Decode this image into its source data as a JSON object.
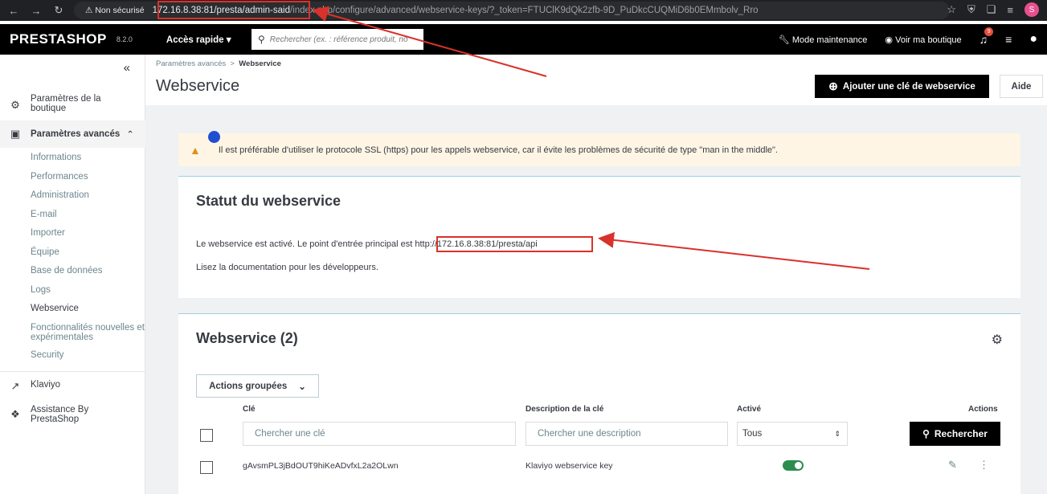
{
  "browser": {
    "security_label": "Non sécurisé",
    "url_host": "172.16.8.38:81/presta/admin-said",
    "url_rest": "/index.php/configure/advanced/webservice-keys/?_token=FTUClK9dQk2zfb-9D_PuDkcCUQMiD6b0EMmbolv_Rro",
    "profile_initial": "S"
  },
  "header": {
    "logo": "PRESTASHOP",
    "version": "8.2.0",
    "quick_access": "Accès rapide",
    "search_placeholder": "Rechercher (ex. : référence produit, no",
    "maintenance": "Mode maintenance",
    "view_shop": "Voir ma boutique",
    "notification_count": "9"
  },
  "sidebar": {
    "shop_params": "Paramètres de la boutique",
    "advanced_params": "Paramètres avancés",
    "sub_items": [
      "Informations",
      "Performances",
      "Administration",
      "E-mail",
      "Importer",
      "Équipe",
      "Base de données",
      "Logs",
      "Webservice",
      "Fonctionnalités nouvelles et expérimentales",
      "Security"
    ],
    "klaviyo": "Klaviyo",
    "assistance": "Assistance By PrestaShop"
  },
  "page": {
    "breadcrumb_parent": "Paramètres avancés",
    "breadcrumb_sep": ">",
    "breadcrumb_current": "Webservice",
    "title": "Webservice",
    "add_key_button": "Ajouter une clé de webservice",
    "help_button": "Aide"
  },
  "alert": {
    "text": "Il est préférable d'utiliser le protocole SSL (https) pour les appels webservice, car il évite les problèmes de sécurité de type \"man in the middle\"."
  },
  "status_card": {
    "title": "Statut du webservice",
    "line1_prefix": "Le webservice est activé. Le point d'entrée principal est",
    "endpoint": "http://172.16.8.38:81/presta/api",
    "line2_prefix": "Lisez la",
    "doc_link": "documentation pour les développeurs",
    "line2_suffix": "."
  },
  "list_card": {
    "title": "Webservice (2)",
    "bulk_actions": "Actions groupées",
    "columns": {
      "key": "Clé",
      "description": "Description de la clé",
      "active": "Activé",
      "actions": "Actions"
    },
    "filters": {
      "key_placeholder": "Chercher une clé",
      "description_placeholder": "Chercher une description",
      "active_value": "Tous",
      "search_button": "Rechercher"
    },
    "rows": [
      {
        "key": "gAvsmPL3jBdOUT9hiKeADvfxL2a2OLwn",
        "description": "Klaviyo webservice key",
        "active": true
      }
    ]
  },
  "colors": {
    "annotation": "#d9312b",
    "header_bg": "#000000",
    "alert_bg": "#fff5e5",
    "toggle_on": "#2c8d4f"
  }
}
